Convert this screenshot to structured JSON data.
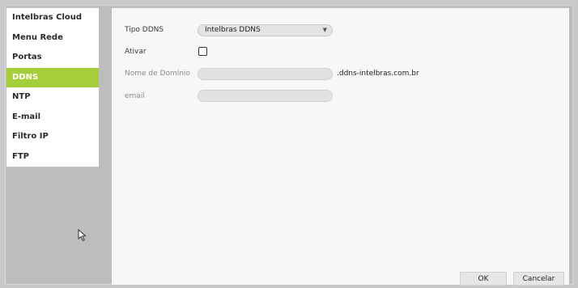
{
  "sidebar": {
    "items": [
      {
        "label": "Intelbras Cloud"
      },
      {
        "label": "Menu Rede"
      },
      {
        "label": "Portas"
      },
      {
        "label": "DDNS"
      },
      {
        "label": "NTP"
      },
      {
        "label": "E-mail"
      },
      {
        "label": "Filtro IP"
      },
      {
        "label": "FTP"
      }
    ],
    "active_index": 3
  },
  "form": {
    "tipo_label": "Tipo DDNS",
    "tipo_value": "Intelbras DDNS",
    "ativar_label": "Ativar",
    "ativar_checked": false,
    "domain_label": "Nome de Domínio",
    "domain_value": "",
    "domain_suffix": ".ddns-intelbras.com.br",
    "email_label": "email",
    "email_value": ""
  },
  "buttons": {
    "ok": "OK",
    "cancel": "Cancelar"
  },
  "colors": {
    "accent": "#a6ce39"
  }
}
